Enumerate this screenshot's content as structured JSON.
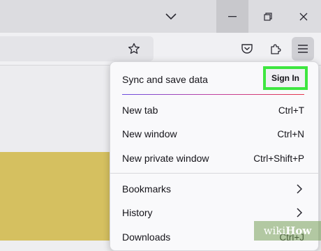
{
  "window": {
    "icons": [
      "chevron-down-icon",
      "minimize-icon",
      "restore-icon",
      "close-icon"
    ]
  },
  "toolbar": {
    "icons": [
      "star-icon",
      "pocket-icon",
      "extensions-icon",
      "hamburger-menu-icon"
    ]
  },
  "menu": {
    "sync_label": "Sync and save data",
    "sign_in_label": "Sign In",
    "items": [
      {
        "label": "New tab",
        "shortcut": "Ctrl+T"
      },
      {
        "label": "New window",
        "shortcut": "Ctrl+N"
      },
      {
        "label": "New private window",
        "shortcut": "Ctrl+Shift+P"
      },
      {
        "label": "Bookmarks",
        "submenu": true
      },
      {
        "label": "History",
        "submenu": true
      },
      {
        "label": "Downloads",
        "shortcut": "Ctrl+J"
      }
    ]
  },
  "watermark": {
    "wiki": "wiki",
    "how": "How"
  },
  "colors": {
    "highlight": "#3ee640",
    "content_block": "#d5c060"
  }
}
